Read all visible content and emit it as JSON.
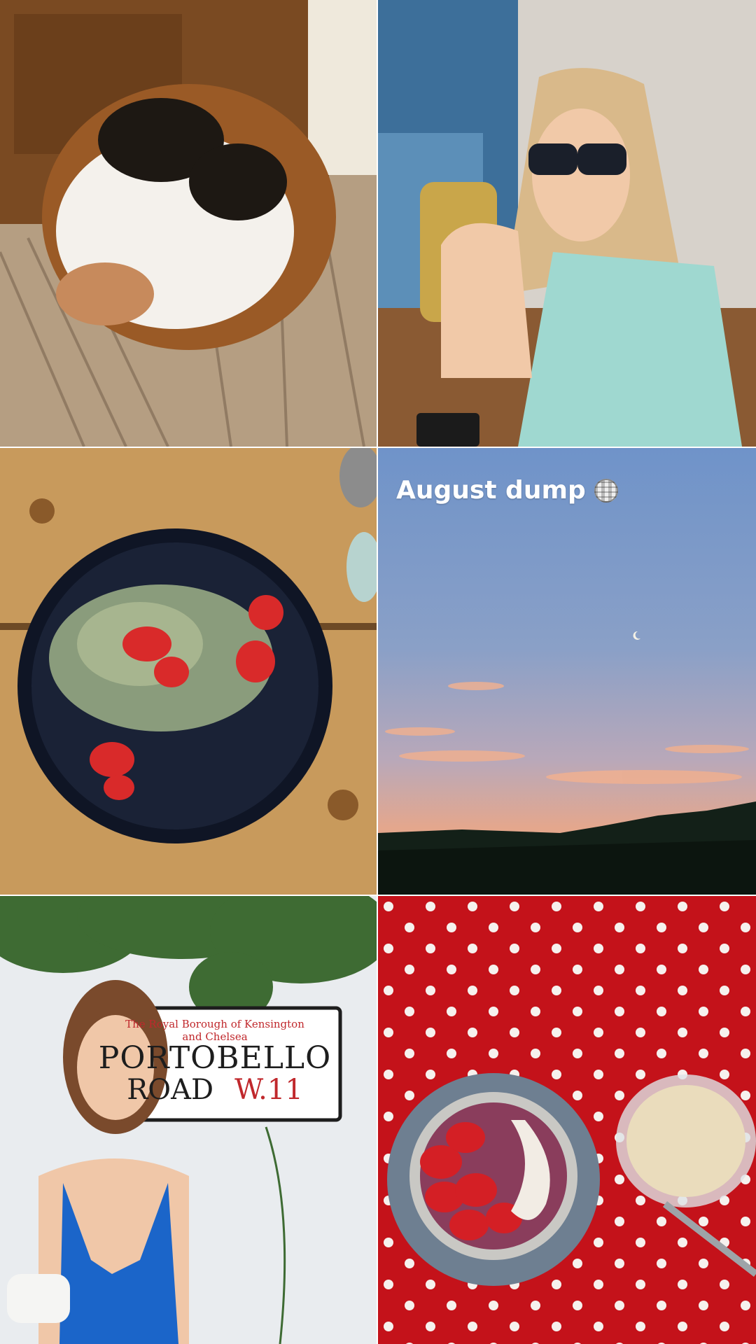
{
  "story": {
    "title": "August dump",
    "title_emoji": "mirror-ball-icon"
  },
  "street_sign": {
    "line1": "The Royal Borough of Kensington",
    "line2": "and Chelsea",
    "road_line1": "PORTOBELLO",
    "road_line2": "ROAD",
    "postcode": "W.11"
  },
  "colors": {
    "sign_red": "#c0282c",
    "tablecloth_red": "#c4121a"
  }
}
